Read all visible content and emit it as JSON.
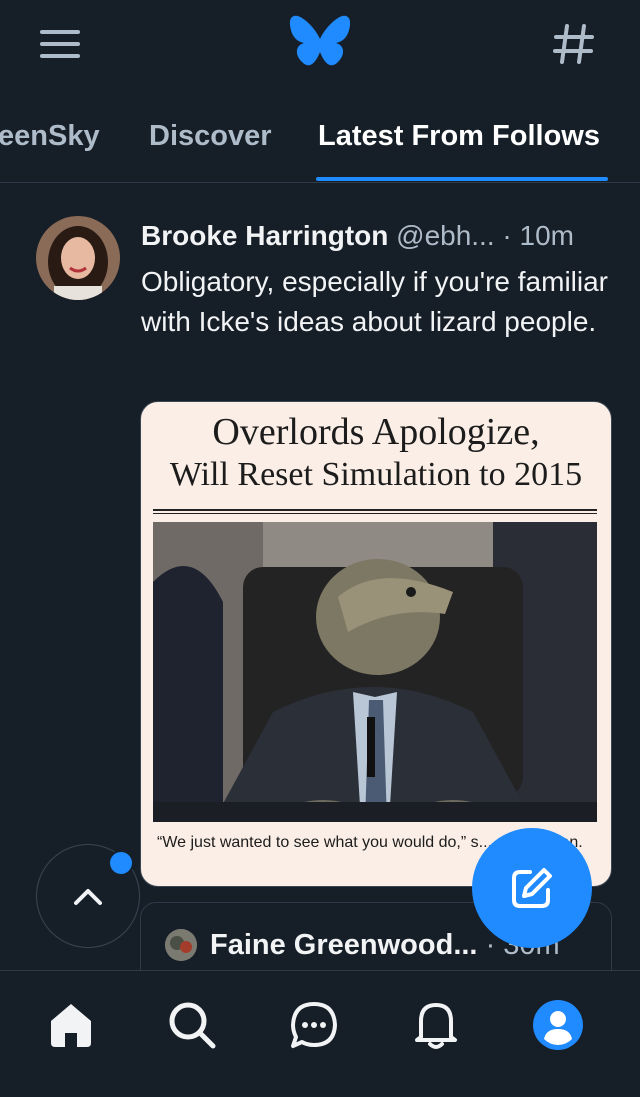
{
  "header": {
    "menu_icon": "hamburger-menu-icon",
    "logo_icon": "butterfly-logo-icon",
    "feeds_icon": "hashtag-icon",
    "brand_color": "#208bfe"
  },
  "tabs": [
    {
      "label": "eenSky",
      "active": false
    },
    {
      "label": "Discover",
      "active": false
    },
    {
      "label": "Latest From Follows",
      "active": true
    }
  ],
  "post": {
    "author": "Brooke Harrington",
    "handle": "@ebh...",
    "separator": "·",
    "time": "10m",
    "text": "Obligatory, especially if you're familiar with Icke's ideas about lizard people.",
    "image": {
      "headline_line1": "Overlords Apologize,",
      "headline_line2": "Will Reset Simulation to 2015",
      "caption": "“We just wanted to see what you would do,” s... spokesman."
    }
  },
  "next_post": {
    "author": "Faine Greenwood...",
    "separator": "·",
    "time": "30m"
  },
  "floating": {
    "scroll_top_icon": "chevron-up-icon",
    "compose_icon": "compose-icon",
    "unread_dot_color": "#208bfe"
  },
  "bottom_nav": [
    {
      "icon": "home-icon",
      "active": true
    },
    {
      "icon": "search-icon",
      "active": false
    },
    {
      "icon": "chat-icon",
      "active": false
    },
    {
      "icon": "bell-icon",
      "active": false
    },
    {
      "icon": "profile-icon",
      "active": false
    }
  ]
}
